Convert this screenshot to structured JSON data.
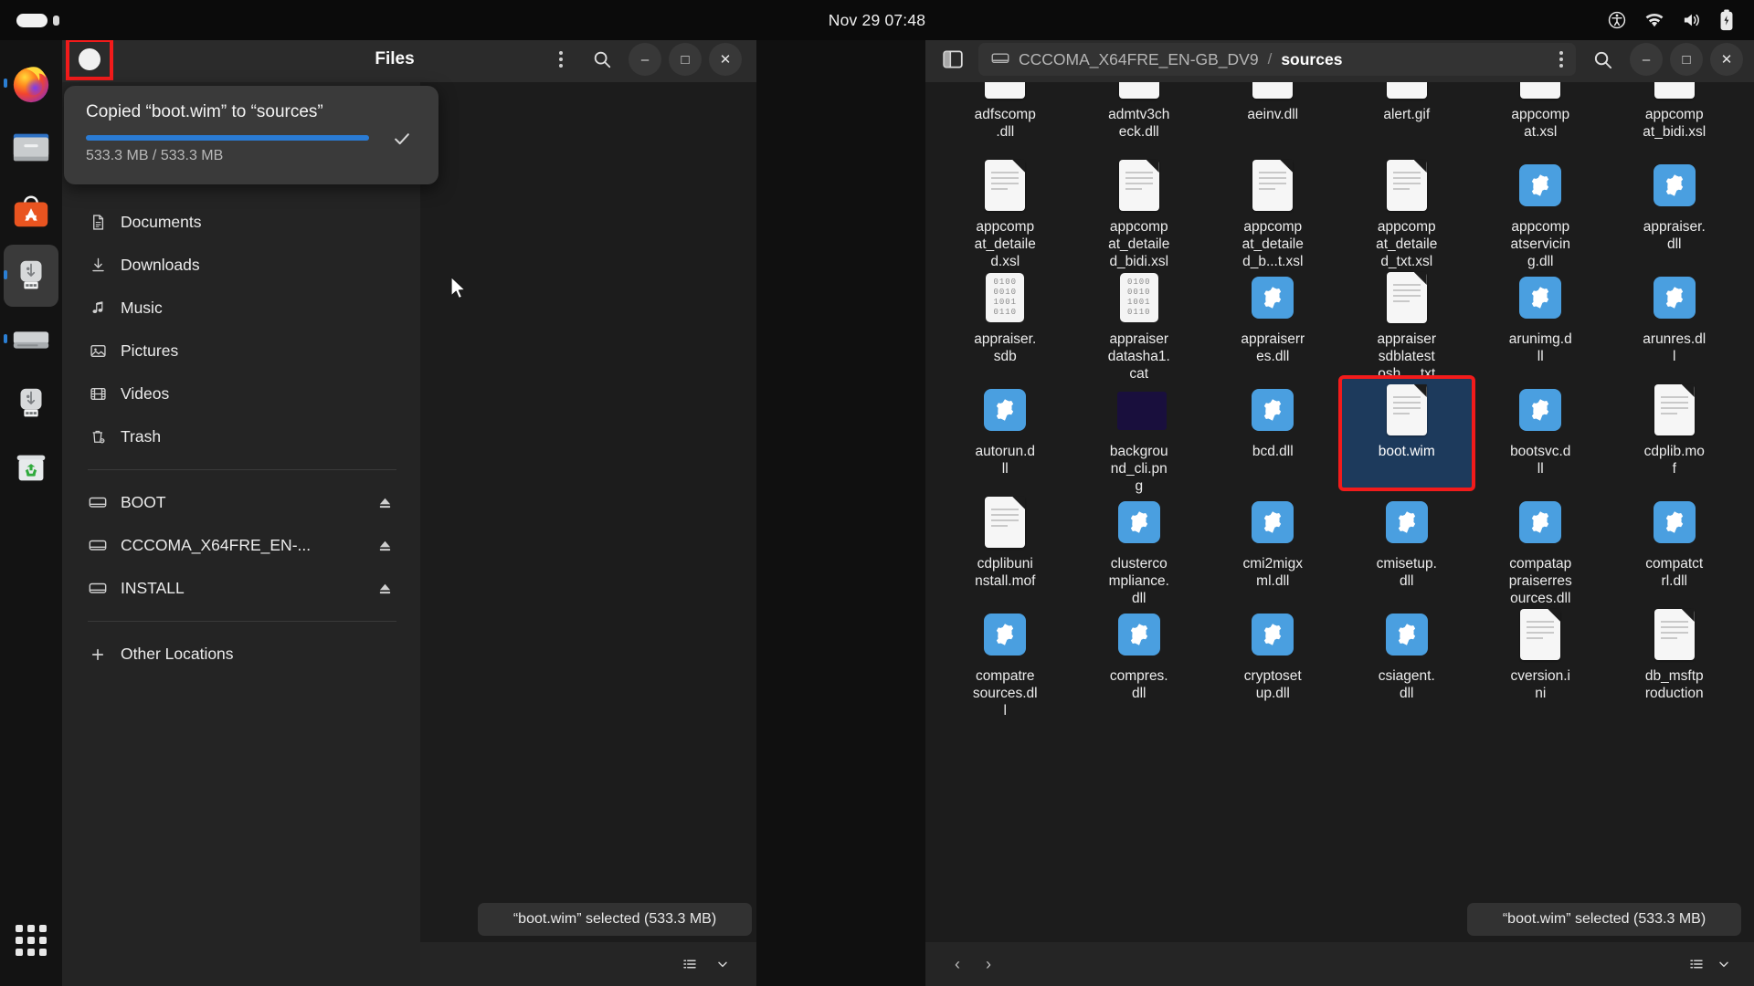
{
  "topbar": {
    "clock": "Nov 29 07:48",
    "left_indicator": "activities-pill",
    "icons": [
      "accessibility-icon",
      "wifi-icon",
      "volume-icon",
      "battery-icon"
    ]
  },
  "dock": {
    "items": [
      {
        "name": "firefox",
        "label": "Firefox",
        "active": true,
        "running_bg": false
      },
      {
        "name": "files",
        "label": "Files",
        "active": false,
        "running_bg": false
      },
      {
        "name": "ubuntu-software",
        "label": "Ubuntu Software",
        "active": false,
        "running_bg": false
      },
      {
        "name": "usb-drive-1",
        "label": "CCCOMA_X64FRE_EN-GB_DV9",
        "active": true,
        "running_bg": true
      },
      {
        "name": "hard-drive",
        "label": "INSTALL",
        "active": true,
        "running_bg": false
      },
      {
        "name": "usb-drive-2",
        "label": "BOOT",
        "active": false,
        "running_bg": false
      },
      {
        "name": "trash",
        "label": "Trash",
        "active": false,
        "running_bg": false
      }
    ],
    "show_apps_label": "Show Applications"
  },
  "left_window": {
    "title": "Files",
    "sidebar_toggle": "sidebar-toggle",
    "menu": "main-menu",
    "window_controls": {
      "minimize": "–",
      "maximize": "□",
      "close": "✕"
    },
    "toast": {
      "message": "Copied “boot.wim” to “sources”",
      "progress_text": "533.3 MB / 533.3 MB",
      "progress_percent": 100,
      "accent": "#2a7bd4",
      "done_icon": "checkmark-icon"
    },
    "places": [
      {
        "label": "Documents",
        "icon": "document-icon",
        "eject": false
      },
      {
        "label": "Downloads",
        "icon": "download-icon",
        "eject": false
      },
      {
        "label": "Music",
        "icon": "music-icon",
        "eject": false
      },
      {
        "label": "Pictures",
        "icon": "picture-icon",
        "eject": false
      },
      {
        "label": "Videos",
        "icon": "video-icon",
        "eject": false
      },
      {
        "label": "Trash",
        "icon": "trash-icon",
        "eject": false
      }
    ],
    "devices": [
      {
        "label": "BOOT",
        "icon": "drive-icon",
        "eject": true
      },
      {
        "label": "CCCOMA_X64FRE_EN-...",
        "icon": "drive-icon",
        "eject": true
      },
      {
        "label": "INSTALL",
        "icon": "drive-icon",
        "eject": true
      }
    ],
    "other_locations": {
      "label": "Other Locations",
      "icon": "plus-icon"
    },
    "status": "“boot.wim” selected (533.3 MB)",
    "bottom": {
      "list_view": "list-view-icon",
      "view_options": "chevron-down-icon"
    }
  },
  "right_window": {
    "sidebar_toggle": "sidebar-toggle",
    "breadcrumb": {
      "drive": "CCCOMA_X64FRE_EN-GB_DV9",
      "separator": "/",
      "current": "sources"
    },
    "path_menu": "path-kebab-icon",
    "search": "search-icon",
    "window_controls": {
      "minimize": "–",
      "maximize": "□",
      "close": "✕"
    },
    "status": "“boot.wim” selected (533.3 MB)",
    "bottom": {
      "back": "‹",
      "forward": "›",
      "list_view": "list-view-icon",
      "view_options": "chevron-down-icon"
    },
    "files": [
      {
        "name": "adfscomp\n.dll",
        "type": "doc",
        "selected": false
      },
      {
        "name": "admtv3ch\neck.dll",
        "type": "doc",
        "selected": false
      },
      {
        "name": "aeinv.dll",
        "type": "doc",
        "selected": false
      },
      {
        "name": "alert.gif",
        "type": "doc",
        "selected": false
      },
      {
        "name": "appcomp\nat.xsl",
        "type": "doc",
        "selected": false
      },
      {
        "name": "appcomp\nat_bidi.xsl",
        "type": "doc",
        "selected": false
      },
      {
        "name": "appcomp\nat_detaile\nd.xsl",
        "type": "doc",
        "selected": false
      },
      {
        "name": "appcomp\nat_detaile\nd_bidi.xsl",
        "type": "doc",
        "selected": false
      },
      {
        "name": "appcomp\nat_detaile\nd_b...t.xsl",
        "type": "doc",
        "selected": false
      },
      {
        "name": "appcomp\nat_detaile\nd_txt.xsl",
        "type": "doc",
        "selected": false
      },
      {
        "name": "appcomp\natservicin\ng.dll",
        "type": "gear",
        "selected": false
      },
      {
        "name": "appraiser.\ndll",
        "type": "gear",
        "selected": false
      },
      {
        "name": "appraiser.\nsdb",
        "type": "bin",
        "selected": false
      },
      {
        "name": "appraiser\ndatasha1.\ncat",
        "type": "bin",
        "selected": false
      },
      {
        "name": "appraiserr\nes.dll",
        "type": "gear",
        "selected": false
      },
      {
        "name": "appraiser\nsdblatest\nosh... .txt",
        "type": "doc",
        "selected": false
      },
      {
        "name": "arunimg.d\nll",
        "type": "gear",
        "selected": false
      },
      {
        "name": "arunres.dl\nl",
        "type": "gear",
        "selected": false
      },
      {
        "name": "autorun.d\nll",
        "type": "gear",
        "selected": false
      },
      {
        "name": "backgrou\nnd_cli.pn\ng",
        "type": "png",
        "selected": false
      },
      {
        "name": "bcd.dll",
        "type": "gear",
        "selected": false
      },
      {
        "name": "boot.wim",
        "type": "doc",
        "selected": true
      },
      {
        "name": "bootsvc.d\nll",
        "type": "gear",
        "selected": false
      },
      {
        "name": "cdplib.mo\nf",
        "type": "doc",
        "selected": false
      },
      {
        "name": "cdplibuni\nnstall.mof",
        "type": "doc",
        "selected": false
      },
      {
        "name": "clusterco\nmpliance.\ndll",
        "type": "gear",
        "selected": false
      },
      {
        "name": "cmi2migx\nml.dll",
        "type": "gear",
        "selected": false
      },
      {
        "name": "cmisetup.\ndll",
        "type": "gear",
        "selected": false
      },
      {
        "name": "compatap\npraiserres\nources.dll",
        "type": "gear",
        "selected": false
      },
      {
        "name": "compatct\nrl.dll",
        "type": "gear",
        "selected": false
      },
      {
        "name": "compatre\nsources.dl\nl",
        "type": "gear",
        "selected": false
      },
      {
        "name": "compres.\ndll",
        "type": "gear",
        "selected": false
      },
      {
        "name": "cryptoset\nup.dll",
        "type": "gear",
        "selected": false
      },
      {
        "name": "csiagent.\ndll",
        "type": "gear",
        "selected": false
      },
      {
        "name": "cversion.i\nni",
        "type": "doc",
        "selected": false
      },
      {
        "name": "db_msftp\nroduction",
        "type": "doc",
        "selected": false
      }
    ],
    "partial_top_row_hint": "adfscomp.dll row is clipped at top of scroll view"
  },
  "colors": {
    "accent_blue": "#2a7bd4",
    "selection_blue": "#1d3a5c",
    "highlight_red": "#f21b1b",
    "gear_blue": "#4a9fe0",
    "panel_bg": "#0b0b0b",
    "window_bg": "#1c1c1c",
    "header_bg": "#2b2b2b",
    "sidebar_bg": "#242424"
  }
}
